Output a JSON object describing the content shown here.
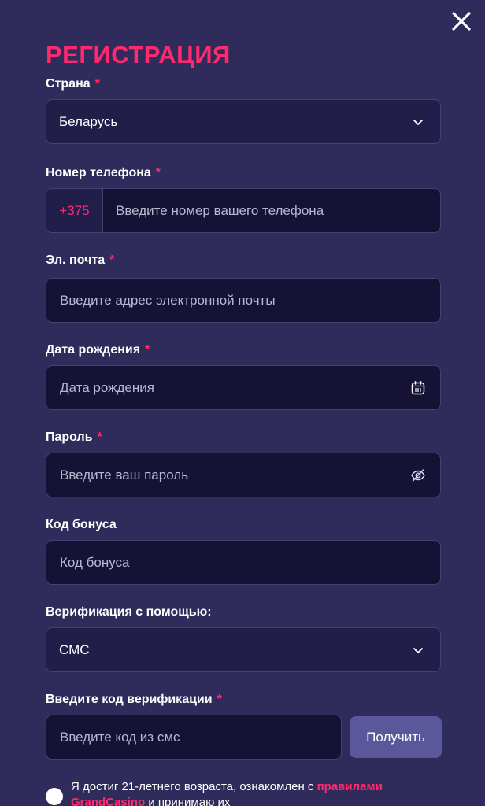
{
  "form": {
    "title": "РЕГИСТРАЦИЯ",
    "required_mark": "*",
    "country": {
      "label": "Страна",
      "value": "Беларусь"
    },
    "phone": {
      "label": "Номер телефона",
      "prefix": "+375",
      "placeholder": "Введите номер вашего телефона"
    },
    "email": {
      "label": "Эл. почта",
      "placeholder": "Введите адрес электронной почты"
    },
    "birthdate": {
      "label": "Дата рождения",
      "placeholder": "Дата рождения"
    },
    "password": {
      "label": "Пароль",
      "placeholder": "Введите ваш пароль"
    },
    "bonus": {
      "label": "Код бонуса",
      "placeholder": "Код бонуса"
    },
    "verification_method": {
      "label": "Верификация с помощью:",
      "value": "СМС"
    },
    "verification_code": {
      "label": "Введите код верификации",
      "placeholder": "Введите код из смс",
      "button_label": "Получить"
    },
    "agreement": {
      "text_before": "Я достиг 21-летнего возраста, ознакомлен с ",
      "link_text": "правилами GrandCasino",
      "text_after": " и принимаю их"
    }
  },
  "icons": {
    "close": "close-icon",
    "chevron": "chevron-down-icon",
    "calendar": "calendar-icon",
    "password_toggle": "eye-off-icon"
  },
  "colors": {
    "background": "#2f2c5b",
    "accent": "#ff2a6d",
    "field_bg": "#151236",
    "select_bg": "#211e49",
    "button_bg": "#5a579a"
  }
}
